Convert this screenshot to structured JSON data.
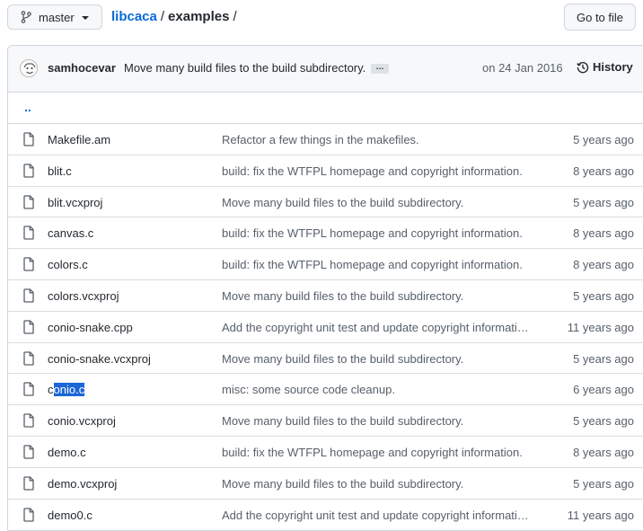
{
  "toolbar": {
    "branch": "master",
    "repo": "libcaca",
    "directory": "examples",
    "separator": "/",
    "goto_file": "Go to file"
  },
  "commit": {
    "author": "samhocevar",
    "message": "Move many build files to the build subdirectory.",
    "date": "on 24 Jan 2016",
    "history_label": "History"
  },
  "parent_dir": "..",
  "files": [
    {
      "name": "Makefile.am",
      "message": "Refactor a few things in the makefiles.",
      "age": "5 years ago"
    },
    {
      "name": "blit.c",
      "message": "build: fix the WTFPL homepage and copyright information.",
      "age": "8 years ago"
    },
    {
      "name": "blit.vcxproj",
      "message": "Move many build files to the build subdirectory.",
      "age": "5 years ago"
    },
    {
      "name": "canvas.c",
      "message": "build: fix the WTFPL homepage and copyright information.",
      "age": "8 years ago"
    },
    {
      "name": "colors.c",
      "message": "build: fix the WTFPL homepage and copyright information.",
      "age": "8 years ago"
    },
    {
      "name": "colors.vcxproj",
      "message": "Move many build files to the build subdirectory.",
      "age": "5 years ago"
    },
    {
      "name": "conio-snake.cpp",
      "message": "Add the copyright unit test and update copyright informati…",
      "age": "11 years ago"
    },
    {
      "name": "conio-snake.vcxproj",
      "message": "Move many build files to the build subdirectory.",
      "age": "5 years ago"
    },
    {
      "name": "conio.c",
      "message": "misc: some source code cleanup.",
      "age": "6 years ago",
      "selected": "onio.c"
    },
    {
      "name": "conio.vcxproj",
      "message": "Move many build files to the build subdirectory.",
      "age": "5 years ago"
    },
    {
      "name": "demo.c",
      "message": "build: fix the WTFPL homepage and copyright information.",
      "age": "8 years ago"
    },
    {
      "name": "demo.vcxproj",
      "message": "Move many build files to the build subdirectory.",
      "age": "5 years ago"
    },
    {
      "name": "demo0.c",
      "message": "Add the copyright unit test and update copyright informati…",
      "age": "11 years ago"
    }
  ],
  "colors": {
    "link": "#0969da",
    "selection": "#1a66d6",
    "muted": "#57606a",
    "border": "#d0d7de"
  }
}
